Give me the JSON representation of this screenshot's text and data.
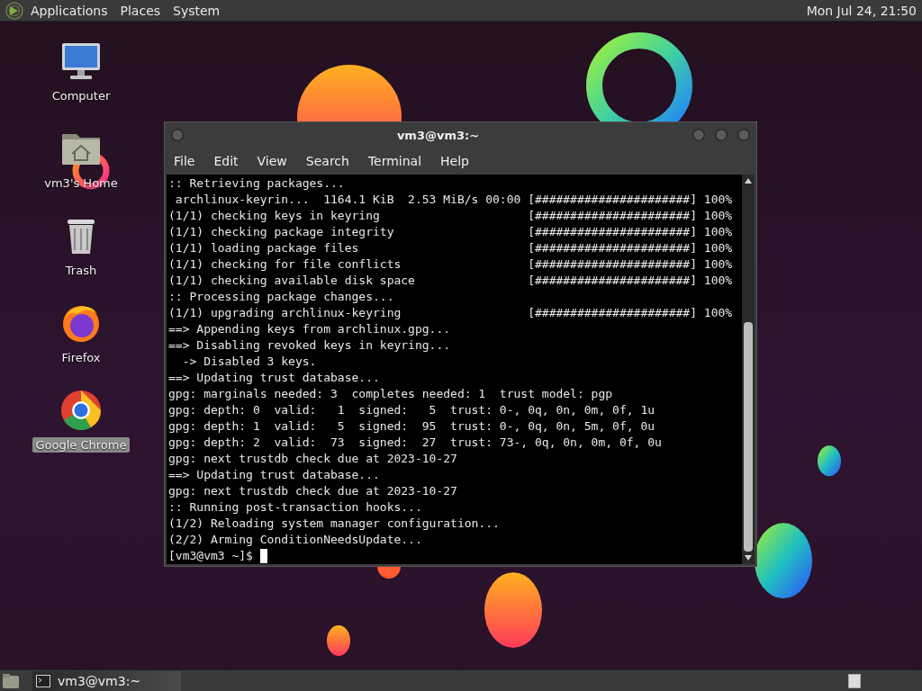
{
  "top_panel": {
    "menus": [
      {
        "label": "Applications"
      },
      {
        "label": "Places"
      },
      {
        "label": "System"
      }
    ],
    "clock": "Mon Jul 24, 21:50"
  },
  "desktop_icons": [
    {
      "kind": "computer",
      "label": "Computer",
      "selected": false
    },
    {
      "kind": "home",
      "label": "vm3's Home",
      "selected": false
    },
    {
      "kind": "trash",
      "label": "Trash",
      "selected": false
    },
    {
      "kind": "firefox",
      "label": "Firefox",
      "selected": false
    },
    {
      "kind": "chrome",
      "label": "Google Chrome",
      "selected": true
    }
  ],
  "terminal": {
    "title": "vm3@vm3:~",
    "menu": [
      "File",
      "Edit",
      "View",
      "Search",
      "Terminal",
      "Help"
    ],
    "lines": [
      ":: Retrieving packages...",
      " archlinux-keyrin...  1164.1 KiB  2.53 MiB/s 00:00 [######################] 100%",
      "(1/1) checking keys in keyring                     [######################] 100%",
      "(1/1) checking package integrity                   [######################] 100%",
      "(1/1) loading package files                        [######################] 100%",
      "(1/1) checking for file conflicts                  [######################] 100%",
      "(1/1) checking available disk space                [######################] 100%",
      ":: Processing package changes...",
      "(1/1) upgrading archlinux-keyring                  [######################] 100%",
      "==> Appending keys from archlinux.gpg...",
      "==> Disabling revoked keys in keyring...",
      "  -> Disabled 3 keys.",
      "==> Updating trust database...",
      "gpg: marginals needed: 3  completes needed: 1  trust model: pgp",
      "gpg: depth: 0  valid:   1  signed:   5  trust: 0-, 0q, 0n, 0m, 0f, 1u",
      "gpg: depth: 1  valid:   5  signed:  95  trust: 0-, 0q, 0n, 5m, 0f, 0u",
      "gpg: depth: 2  valid:  73  signed:  27  trust: 73-, 0q, 0n, 0m, 0f, 0u",
      "gpg: next trustdb check due at 2023-10-27",
      "==> Updating trust database...",
      "gpg: next trustdb check due at 2023-10-27",
      ":: Running post-transaction hooks...",
      "(1/2) Reloading system manager configuration...",
      "(2/2) Arming ConditionNeedsUpdate..."
    ],
    "prompt": "[vm3@vm3 ~]$"
  },
  "taskbar": {
    "windows": [
      {
        "label": "vm3@vm3:~"
      }
    ]
  }
}
